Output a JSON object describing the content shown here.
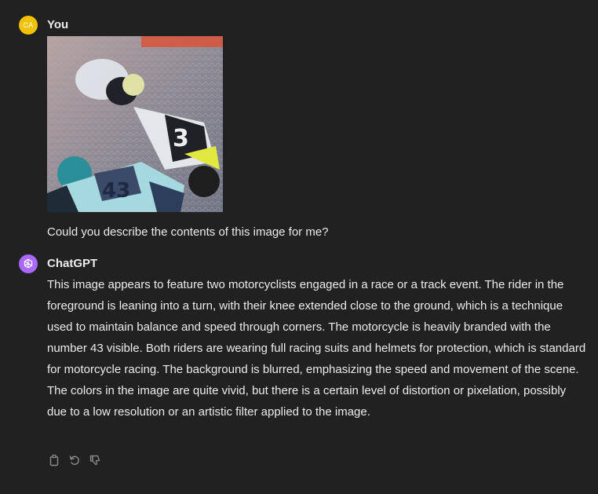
{
  "user_message": {
    "avatar_initials": "CA",
    "author": "You",
    "text": "Could you describe the contents of this image for me?"
  },
  "assistant_message": {
    "author": "ChatGPT",
    "text": "This image appears to feature two motorcyclists engaged in a race or a track event. The rider in the foreground is leaning into a turn, with their knee extended close to the ground, which is a technique used to maintain balance and speed through corners. The motorcycle is heavily branded with the number 43 visible. Both riders are wearing full racing suits and helmets for protection, which is standard for motorcycle racing. The background is blurred, emphasizing the speed and movement of the scene. The colors in the image are quite vivid, but there is a certain level of distortion or pixelation, possibly due to a low resolution or an artistic filter applied to the image."
  },
  "action_icons": [
    "copy-icon",
    "regenerate-icon",
    "thumbs-down-icon"
  ],
  "colors": {
    "background": "#212121",
    "text": "#ececec",
    "user_avatar": "#f2c200",
    "assistant_avatar": "#ab68ff",
    "icon": "#8e8e8e"
  }
}
